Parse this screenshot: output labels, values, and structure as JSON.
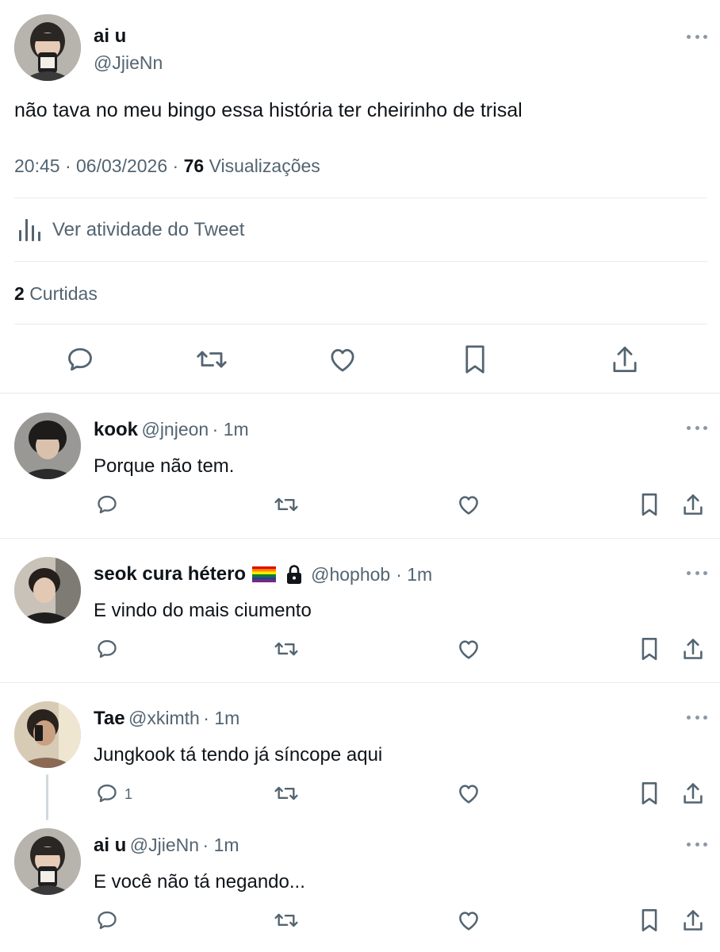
{
  "main_tweet": {
    "author_name": "ai u",
    "author_handle": "@JjieNn",
    "text": "não tava no meu bingo essa história ter cheirinho de trisal",
    "time": "20:45",
    "date": "06/03/2026",
    "separator": "·",
    "views_count": "76",
    "views_label": "Visualizações",
    "activity_label": "Ver atividade do Tweet",
    "likes_count": "2",
    "likes_label": "Curtidas"
  },
  "replies": [
    {
      "name": "kook",
      "handle": "@jnjeon",
      "time": "· 1m",
      "text": "Porque não tem."
    },
    {
      "name": "seok cura hétero",
      "badges": [
        "rainbow-flag",
        "lock"
      ],
      "handle": "@hophob",
      "time": "· 1m",
      "text": "E vindo do mais ciumento"
    },
    {
      "name": "Tae",
      "handle": "@xkimth",
      "time": "· 1m",
      "text": "Jungkook tá tendo já síncope aqui",
      "reply_count": "1"
    },
    {
      "name": "ai u",
      "handle": "@JjieNn",
      "time": "· 1m",
      "text": "E você não tá negando..."
    }
  ],
  "icons": [
    "reply-icon",
    "retweet-icon",
    "like-icon",
    "bookmark-icon",
    "share-icon",
    "more-icon",
    "analytics-icon",
    "lock-icon",
    "rainbow-flag-icon"
  ],
  "colors": {
    "text": "#0f1419",
    "muted": "#536471",
    "divider": "#e6ecf0"
  }
}
